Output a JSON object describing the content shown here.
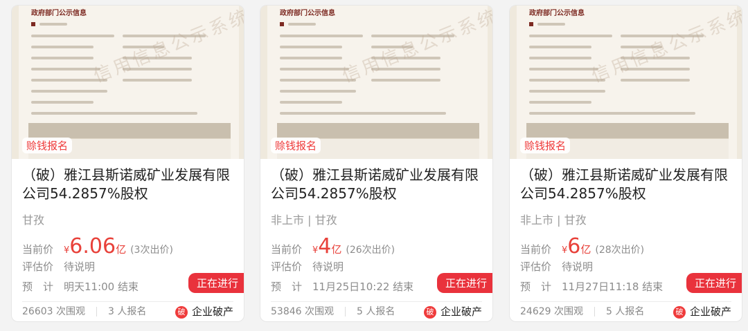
{
  "cards": [
    {
      "tag": "赊钱报名",
      "title": "（破）雅江县斯诺威矿业发展有限公司54.2857%股权",
      "region": "甘孜",
      "current_label": "当前价",
      "currency": "¥",
      "price": "6.06",
      "price_unit": "亿",
      "bids": "(3次出价)",
      "eval_label": "评估价",
      "eval_value": "待说明",
      "end_label": "预　计",
      "end_value": "明天11:00 结束",
      "status": "正在进行",
      "views": "26603 次围观",
      "signups": "3 人报名",
      "badge_char": "破",
      "badge_label": "企业破产",
      "doc_heading": "政府部门公示信息",
      "watermark": "信用信息公示系统"
    },
    {
      "tag": "赊钱报名",
      "title": "（破）雅江县斯诺威矿业发展有限公司54.2857%股权",
      "region": "非上市 | 甘孜",
      "current_label": "当前价",
      "currency": "¥",
      "price": "4",
      "price_unit": "亿",
      "bids": "(26次出价)",
      "eval_label": "评估价",
      "eval_value": "待说明",
      "end_label": "预　计",
      "end_value": "11月25日10:22 结束",
      "status": "正在进行",
      "views": "53846 次围观",
      "signups": "5 人报名",
      "badge_char": "破",
      "badge_label": "企业破产",
      "doc_heading": "政府部门公示信息",
      "watermark": "信用信息公示系统"
    },
    {
      "tag": "赊钱报名",
      "title": "（破）雅江县斯诺威矿业发展有限公司54.2857%股权",
      "region": "非上市 | 甘孜",
      "current_label": "当前价",
      "currency": "¥",
      "price": "6",
      "price_unit": "亿",
      "bids": "(28次出价)",
      "eval_label": "评估价",
      "eval_value": "待说明",
      "end_label": "预　计",
      "end_value": "11月27日11:18 结束",
      "status": "正在进行",
      "views": "24629 次围观",
      "signups": "5 人报名",
      "badge_char": "破",
      "badge_label": "企业破产",
      "doc_heading": "政府部门公示信息",
      "watermark": "信用信息公示系统"
    }
  ],
  "colors": {
    "accent": "#e8413a",
    "status_bg": "#e9323c",
    "muted": "#8c8c8c"
  }
}
